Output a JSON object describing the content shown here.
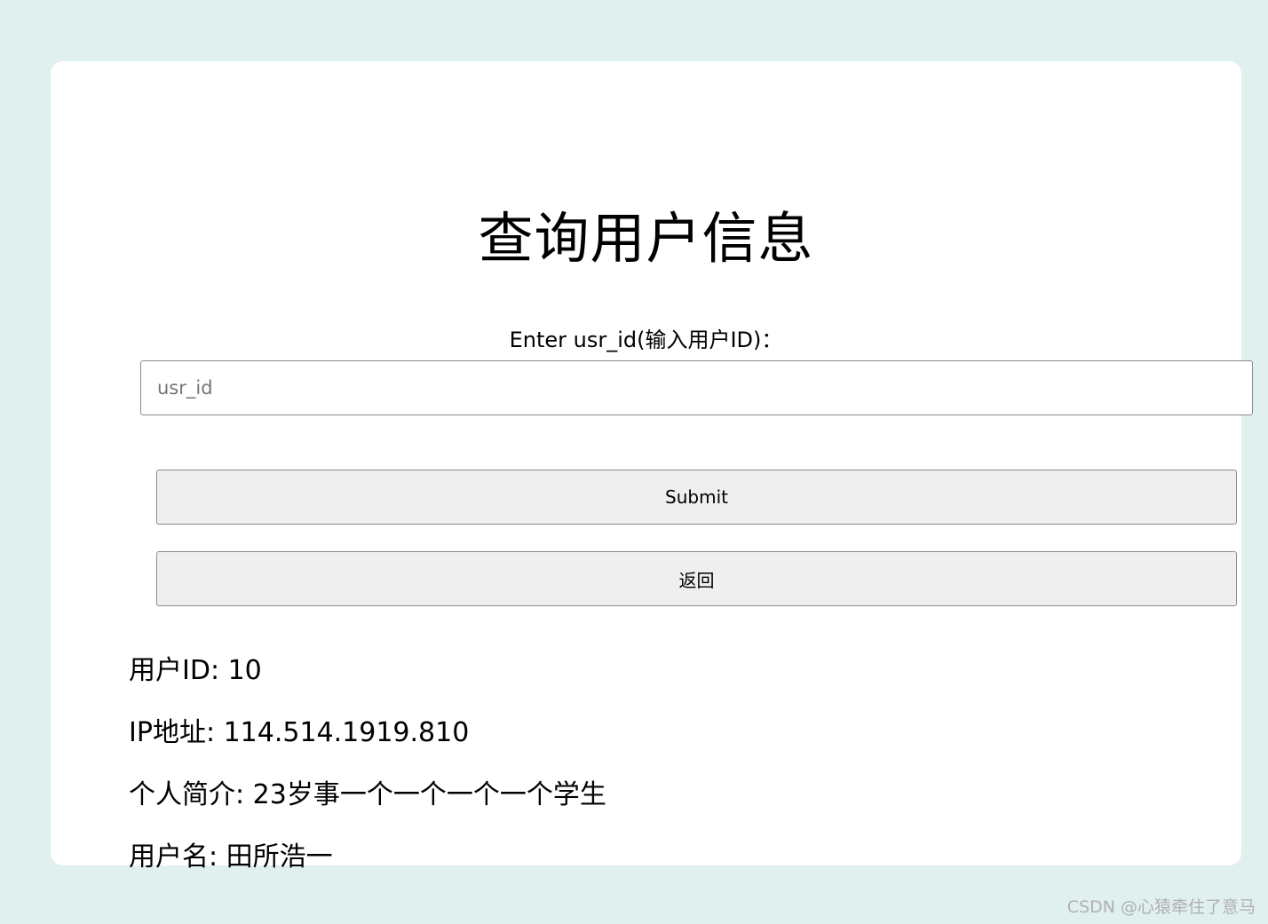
{
  "page": {
    "title": "查询用户信息"
  },
  "form": {
    "label": "Enter usr_id(输入用户ID)：",
    "input_placeholder": "usr_id",
    "input_value": "",
    "submit_label": "Submit",
    "back_label": "返回"
  },
  "result": {
    "user_id_line": "用户ID: 10",
    "ip_line": "IP地址: 114.514.1919.810",
    "bio_line": "个人简介: 23岁事一个一个一个一个学生",
    "username_line": "用户名: 田所浩一"
  },
  "watermark": {
    "text": "CSDN @心猿牵住了意马"
  },
  "colors": {
    "background": "#e0f0ef",
    "card": "#ffffff",
    "button": "#efefef",
    "border": "#8a8a8a"
  }
}
